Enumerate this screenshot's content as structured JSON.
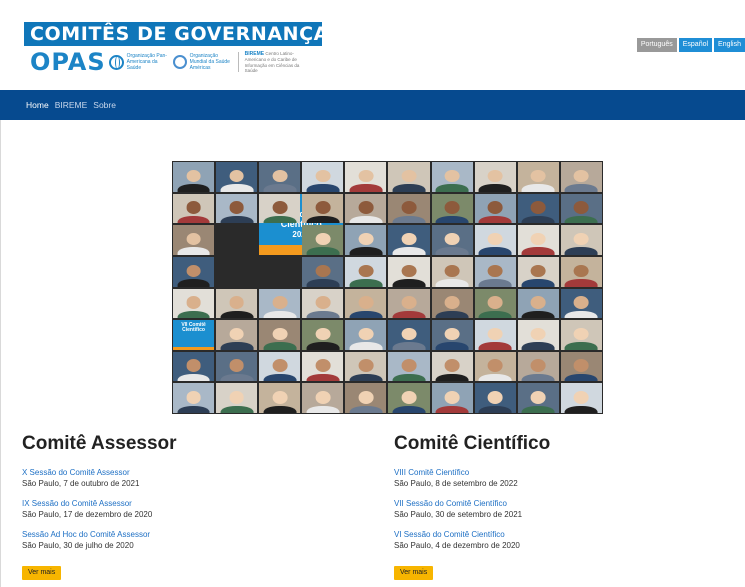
{
  "header": {
    "banner_title": "COMITÊS DE GOVERNANÇA",
    "logo_word": "OPAS",
    "org_paho": "Organização Pan-Americana da Saúde",
    "org_who": "Organização Mundial da Saúde",
    "org_who_region": "Américas",
    "bireme_title": "BIREME",
    "bireme_desc": "Centro Latino-Americano e do Caribe de Informação em Ciências da Saúde"
  },
  "languages": [
    {
      "label": "Português",
      "active": true
    },
    {
      "label": "Español",
      "active": false
    },
    {
      "label": "English",
      "active": false
    }
  ],
  "nav": [
    {
      "label": "Home",
      "active": true
    },
    {
      "label": "BIREME",
      "active": false
    },
    {
      "label": "Sobre",
      "active": false
    }
  ],
  "collage": {
    "feature_org": "OPS",
    "feature_title": "VII Comitê Científico",
    "feature_year": "2021"
  },
  "sections": {
    "assessor": {
      "title": "Comitê Assessor",
      "entries": [
        {
          "link": "X Sessão do Comitê Assessor",
          "date": "São Paulo, 7 de outubro de 2021"
        },
        {
          "link": "IX Sessão do Comitê Assessor",
          "date": "São Paulo, 17 de dezembro de 2020"
        },
        {
          "link": "Sessão Ad Hoc do Comitê Assessor",
          "date": "São Paulo, 30 de julho de 2020"
        }
      ],
      "more_label": "Ver mais"
    },
    "cientifico": {
      "title": "Comitê Científico",
      "entries": [
        {
          "link": "VIII Comitê Científico",
          "date": "São Paulo, 8 de setembro de 2022"
        },
        {
          "link": "VII Sessão do Comitê Científico",
          "date": "São Paulo, 30 de setembro de 2021"
        },
        {
          "link": "VI Sessão do Comitê Científico",
          "date": "São Paulo, 4 de dezembro de 2020"
        }
      ],
      "more_label": "Ver mais"
    }
  },
  "colors": {
    "banner": "#0f76b9",
    "navbar": "#064a8f",
    "link": "#1d6fc4",
    "button": "#f7b500"
  }
}
